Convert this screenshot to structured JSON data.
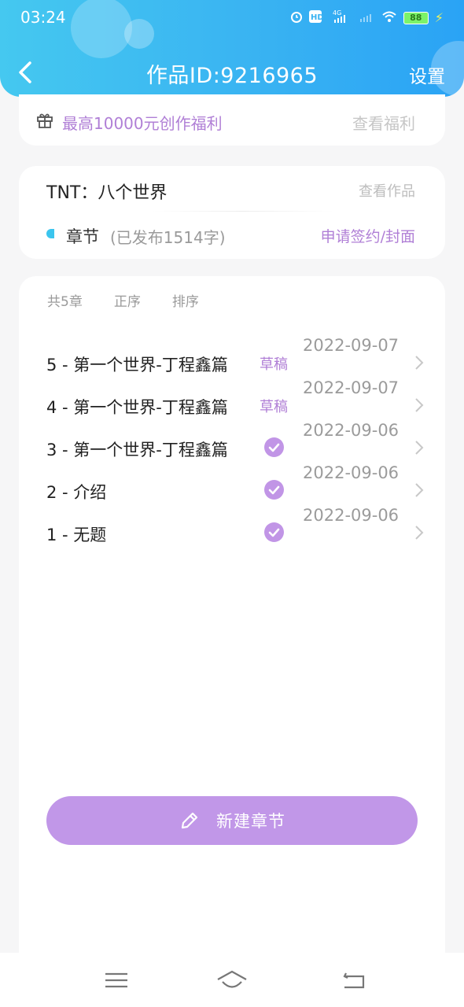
{
  "status_bar": {
    "time": "03:24",
    "network": "4G",
    "battery": "88",
    "icons": [
      "alarm-icon",
      "hd-icon",
      "signal-icon",
      "wifi-icon",
      "battery-icon",
      "charging-icon"
    ]
  },
  "header": {
    "title": "作品ID:9216965",
    "settings_label": "设置",
    "gradient_colors": [
      "#45c8f0",
      "#2aa3f5"
    ]
  },
  "promo": {
    "text": "最高10000元创作福利",
    "link_label": "查看福利",
    "icon": "gift-icon"
  },
  "work": {
    "title": "TNT：八个世界",
    "view_label": "查看作品",
    "chapters_label": "章节",
    "published_count": "(已发布1514字)",
    "apply_label": "申请签约/封面"
  },
  "chapter_list": {
    "total": "共5章",
    "order": "正序",
    "sort": "排序",
    "rows": [
      {
        "title": "5 - 第一个世界-丁程鑫篇",
        "status": "草稿",
        "date": "2022-09-07"
      },
      {
        "title": "4 - 第一个世界-丁程鑫篇",
        "status": "草稿",
        "date": "2022-09-07"
      },
      {
        "title": "3 - 第一个世界-丁程鑫篇",
        "status": "published",
        "date": "2022-09-06"
      },
      {
        "title": "2 - 介绍",
        "status": "published",
        "date": "2022-09-06"
      },
      {
        "title": "1 - 无题",
        "status": "published",
        "date": "2022-09-06"
      }
    ]
  },
  "new_chapter": {
    "label": "新建章节",
    "icon": "pencil-icon"
  },
  "colors": {
    "accent": "#b07fd6",
    "button": "#c197e8",
    "check": "#c195e6"
  }
}
